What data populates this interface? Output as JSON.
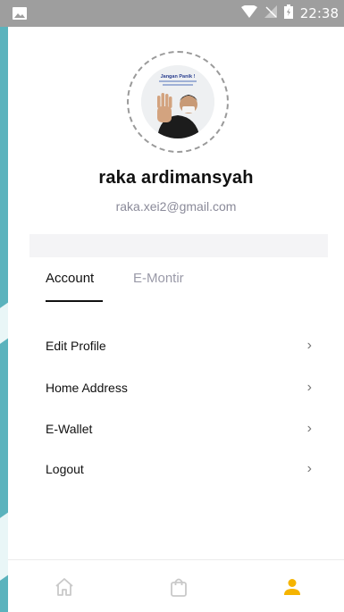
{
  "status_bar": {
    "time": "22:38"
  },
  "profile": {
    "name": "raka ardimansyah",
    "email": "raka.xei2@gmail.com",
    "avatar_text": "Jangan Panik !"
  },
  "tabs": [
    {
      "label": "Account",
      "active": true
    },
    {
      "label": "E-Montir",
      "active": false
    }
  ],
  "menu": [
    {
      "label": "Edit Profile"
    },
    {
      "label": "Home Address"
    },
    {
      "label": "E-Wallet"
    },
    {
      "label": "Logout"
    }
  ],
  "bottom_nav": {
    "items": [
      "home-icon",
      "shopping-bag-icon",
      "person-icon"
    ],
    "active": "person-icon",
    "active_color": "#f5b400",
    "inactive_color": "#c9c9c9"
  },
  "colors": {
    "background": "#5bb3bd",
    "status_bar": "#9e9e9e"
  }
}
